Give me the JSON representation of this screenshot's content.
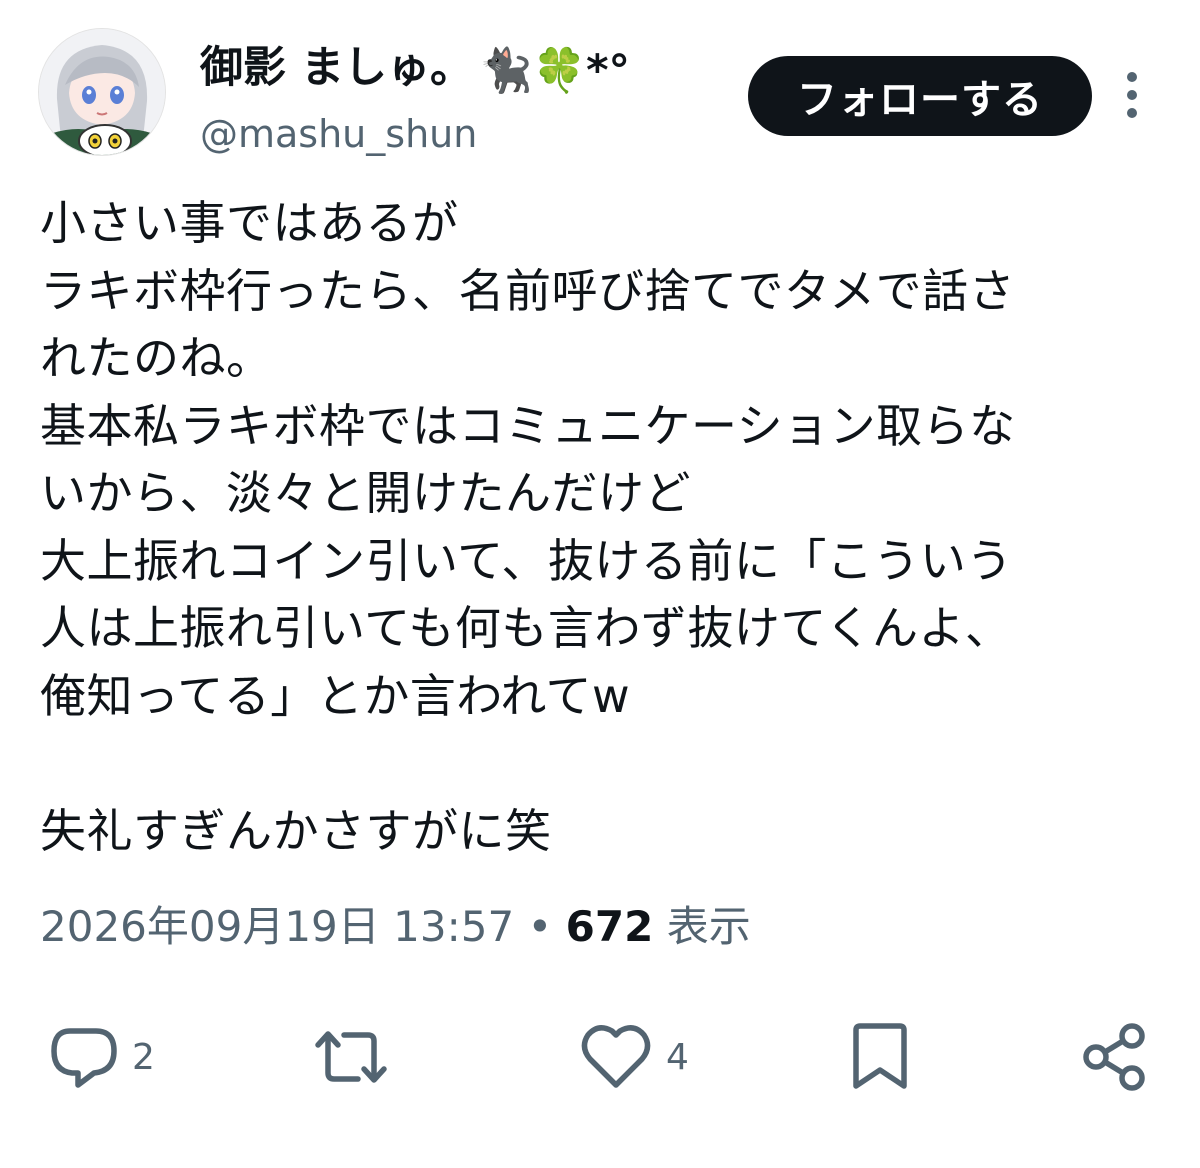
{
  "user": {
    "display_name": "御影 ましゅ。",
    "display_name_suffix": "🐈‍⬛🍀*°",
    "handle": "@mashu_shun"
  },
  "header": {
    "follow_label": "フォローする"
  },
  "tweet": {
    "lines": [
      "小さい事ではあるが",
      "ラキボ枠行ったら、名前呼び捨てでタメで話さ",
      "れたのね。",
      "基本私ラキボ枠ではコミュニケーション取らな",
      "いから、淡々と開けたんだけど",
      "大上振れコイン引いて、抜ける前に「こういう",
      "人は上振れ引いても何も言わず抜けてくんよ、",
      "俺知ってる」とか言われてw",
      "",
      "失礼すぎんかさすがに笑"
    ]
  },
  "meta": {
    "timestamp": "2026年09月19日 13:57",
    "separator": "•",
    "views_count": "672",
    "views_label": "表示"
  },
  "actions": {
    "reply_count": "2",
    "retweet_count": "",
    "like_count": "4"
  },
  "icons": {
    "reply": "reply-icon",
    "retweet": "retweet-icon",
    "like": "heart-icon",
    "bookmark": "bookmark-icon",
    "share": "share-icon",
    "more": "more-vertical-icon"
  },
  "colors": {
    "text_primary": "#0f1419",
    "text_secondary": "#536471",
    "follow_bg": "#0f1419",
    "follow_text": "#ffffff"
  }
}
